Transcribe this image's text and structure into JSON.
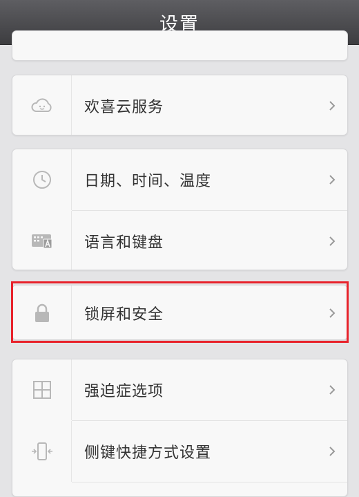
{
  "header": {
    "title": "设置"
  },
  "groups": [
    {
      "items": [
        {
          "label": "欢喜云服务",
          "icon": "cloud-icon"
        }
      ]
    },
    {
      "items": [
        {
          "label": "日期、时间、温度",
          "icon": "clock-icon"
        },
        {
          "label": "语言和键盘",
          "icon": "keyboard-icon"
        }
      ]
    },
    {
      "items": [
        {
          "label": "锁屏和安全",
          "icon": "lock-icon"
        }
      ]
    },
    {
      "items": [
        {
          "label": "强迫症选项",
          "icon": "grid-icon"
        },
        {
          "label": "侧键快捷方式设置",
          "icon": "phone-side-keys-icon"
        }
      ]
    }
  ],
  "highlight_color": "#e8222b"
}
